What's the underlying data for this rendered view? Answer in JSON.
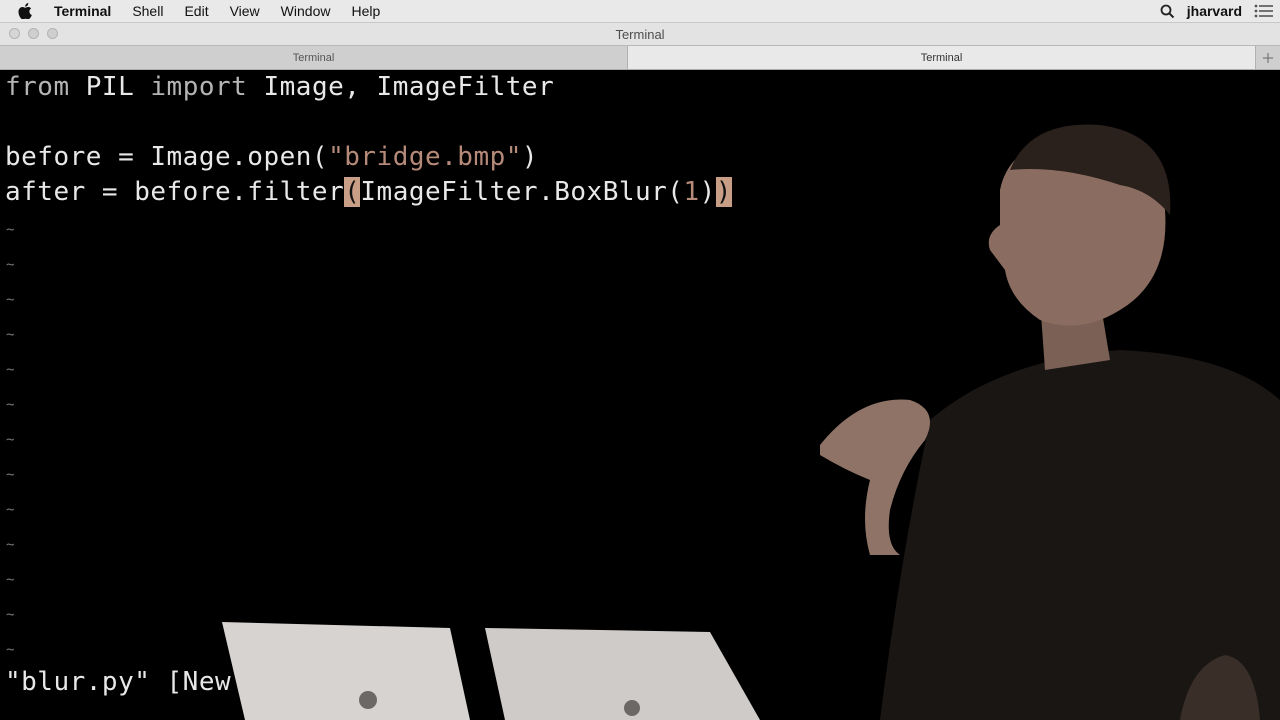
{
  "menubar": {
    "app": "Terminal",
    "items": [
      "Shell",
      "Edit",
      "View",
      "Window",
      "Help"
    ],
    "user": "jharvard"
  },
  "window": {
    "title": "Terminal",
    "tabs": [
      "Terminal",
      "Terminal"
    ]
  },
  "editor": {
    "line1": {
      "kw1": "from",
      "mod": " PIL ",
      "kw2": "import",
      "rest": " Image, ImageFilter"
    },
    "line3": {
      "a": "before = Image.open(",
      "str": "\"bridge.bmp\"",
      "b": ")"
    },
    "line4": {
      "a": "after = before.filter",
      "cursor": "(",
      "b": "ImageFilter.BoxBlur(",
      "num": "1",
      "c": ")",
      "cursor2": ")"
    },
    "tilde": "~",
    "status": "\"blur.py\" [New"
  }
}
